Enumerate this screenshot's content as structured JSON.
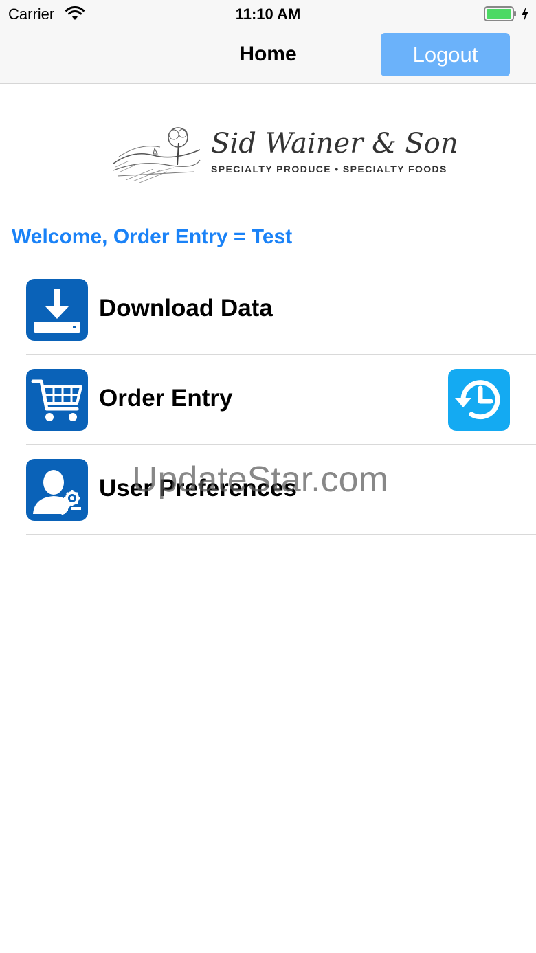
{
  "status_bar": {
    "carrier": "Carrier",
    "time": "11:10 AM",
    "battery_color": "#4cd964"
  },
  "nav": {
    "title": "Home",
    "logout_label": "Logout",
    "logout_color": "#6bb2fa"
  },
  "logo": {
    "title": "Sid Wainer & Son",
    "subtitle": "SPECIALTY PRODUCE • SPECIALTY FOODS"
  },
  "welcome": "Welcome, Order Entry = Test",
  "menu": {
    "items": [
      {
        "label": "Download Data",
        "icon": "download-icon"
      },
      {
        "label": "Order Entry",
        "icon": "shopping-cart-icon",
        "secondary_icon": "history-icon"
      },
      {
        "label": "User Preferences",
        "icon": "user-settings-icon"
      }
    ],
    "tile_color": "#0a62b8",
    "history_color": "#14aaf2"
  },
  "watermark": "UpdateStar.com"
}
